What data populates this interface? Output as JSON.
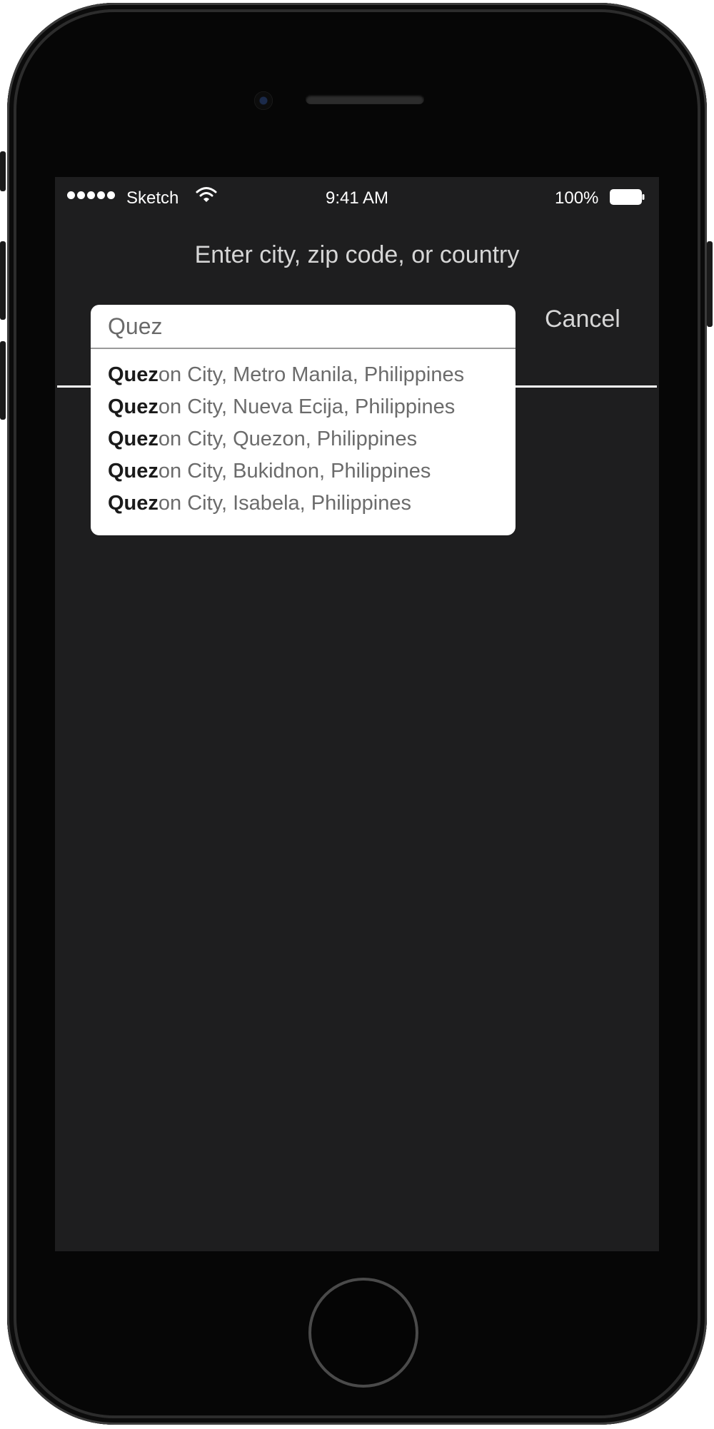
{
  "status_bar": {
    "carrier": "Sketch",
    "time": "9:41 AM",
    "battery_percent": "100%",
    "signal_icon": "signal-dots-icon",
    "wifi_icon": "wifi-icon",
    "battery_icon": "battery-icon",
    "signal_strength": 5,
    "battery_level": 1.0
  },
  "header": {
    "prompt": "Enter city, zip code, or country"
  },
  "search": {
    "value": "Quez",
    "cancel_label": "Cancel"
  },
  "suggestions": [
    {
      "match": "Quez",
      "rest": "on City, Metro Manila, Philippines"
    },
    {
      "match": "Quez",
      "rest": "on City, Nueva Ecija, Philippines"
    },
    {
      "match": "Quez",
      "rest": "on City,  Quezon, Philippines"
    },
    {
      "match": "Quez",
      "rest": "on City,  Bukidnon, Philippines"
    },
    {
      "match": "Quez",
      "rest": "on City,  Isabela, Philippines"
    }
  ],
  "colors": {
    "screen_background": "#1e1e1f",
    "frame": "#060606",
    "dropdown_background": "#ffffff",
    "matched_text": "#1a1a1a",
    "suggestion_text": "#6b6b6b"
  }
}
